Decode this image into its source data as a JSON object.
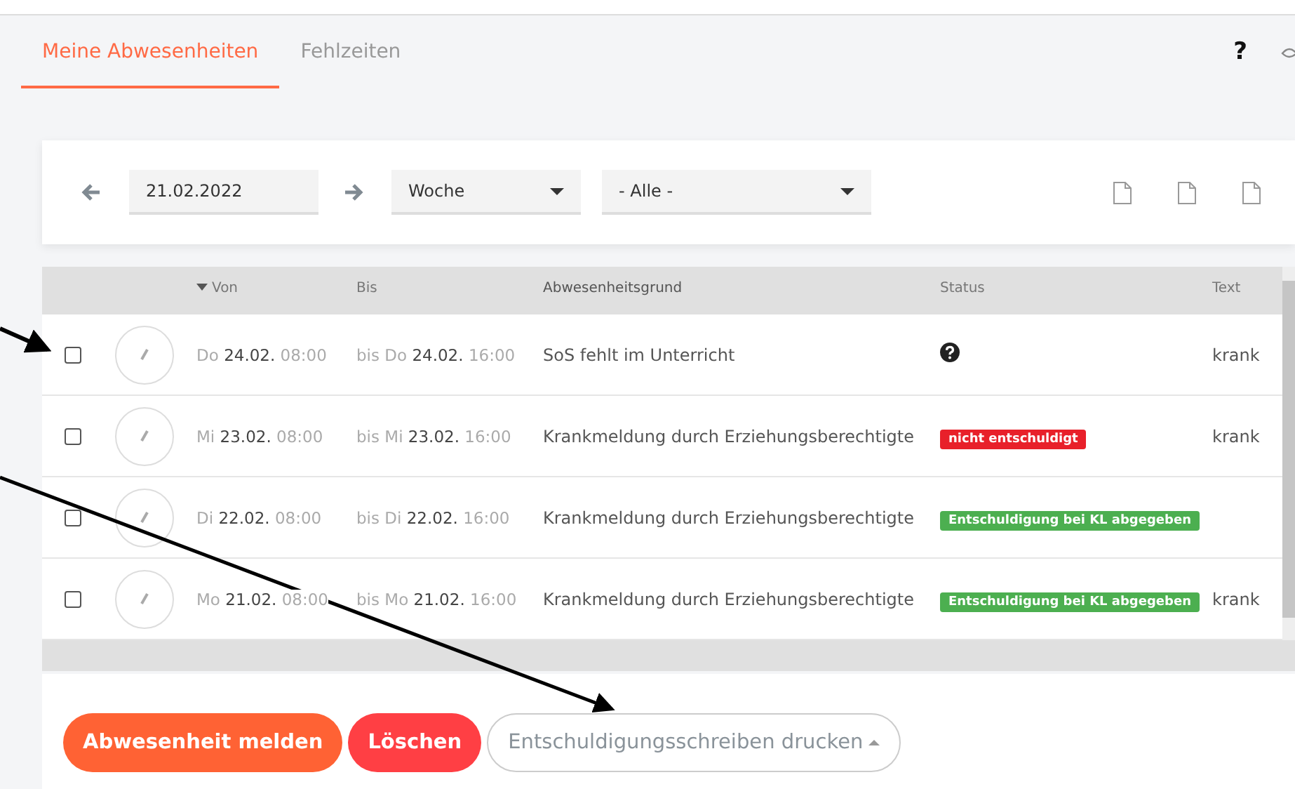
{
  "tabs": [
    {
      "label": "Meine Abwesenheiten",
      "selected": true
    },
    {
      "label": "Fehlzeiten",
      "selected": false
    }
  ],
  "help": "?",
  "filter": {
    "date": "21.02.2022",
    "period": "Woche",
    "category": "- Alle -"
  },
  "table": {
    "columns": [
      "Von",
      "Bis",
      "Abwesenheitsgrund",
      "Status",
      "Text"
    ],
    "rows": [
      {
        "checked": false,
        "day_from": "Do",
        "date_from": "24.02.",
        "time_from": "08:00",
        "day_to": "bis Do",
        "date_to": "24.02.",
        "time_to": "16:00",
        "reason": "SoS fehlt im Unterricht",
        "status": {
          "kind": "unknown"
        },
        "text": "krank"
      },
      {
        "checked": false,
        "day_from": "Mi",
        "date_from": "23.02.",
        "time_from": "08:00",
        "day_to": "bis Mi",
        "date_to": "23.02.",
        "time_to": "16:00",
        "reason": "Krankmeldung durch Erziehungsberechtigte",
        "status": {
          "kind": "badge",
          "label": "nicht entschuldigt",
          "color": "#e8202a"
        },
        "text": "krank"
      },
      {
        "checked": false,
        "day_from": "Di",
        "date_from": "22.02.",
        "time_from": "08:00",
        "day_to": "bis Di",
        "date_to": "22.02.",
        "time_to": "16:00",
        "reason": "Krankmeldung durch Erziehungsberechtigte",
        "status": {
          "kind": "badge",
          "label": "Entschuldigung bei KL abgegeben",
          "color": "#4caf50"
        }
      },
      {
        "checked": false,
        "day_from": "Mo",
        "date_from": "21.02.",
        "time_from": "08:00",
        "day_to": "bis Mo",
        "date_to": "21.02.",
        "time_to": "16:00",
        "reason": "Krankmeldung durch Erziehungsberechtigte",
        "status": {
          "kind": "badge",
          "label": "Entschuldigung bei KL abgegeben",
          "color": "#4caf50"
        },
        "text": "krank"
      }
    ]
  },
  "buttons": [
    {
      "label": "Abwesenheit melden",
      "kind": "primary"
    },
    {
      "label": "Löschen",
      "kind": "danger"
    },
    {
      "label": "Entschuldigungsschreiben drucken",
      "kind": "dropdown"
    }
  ]
}
